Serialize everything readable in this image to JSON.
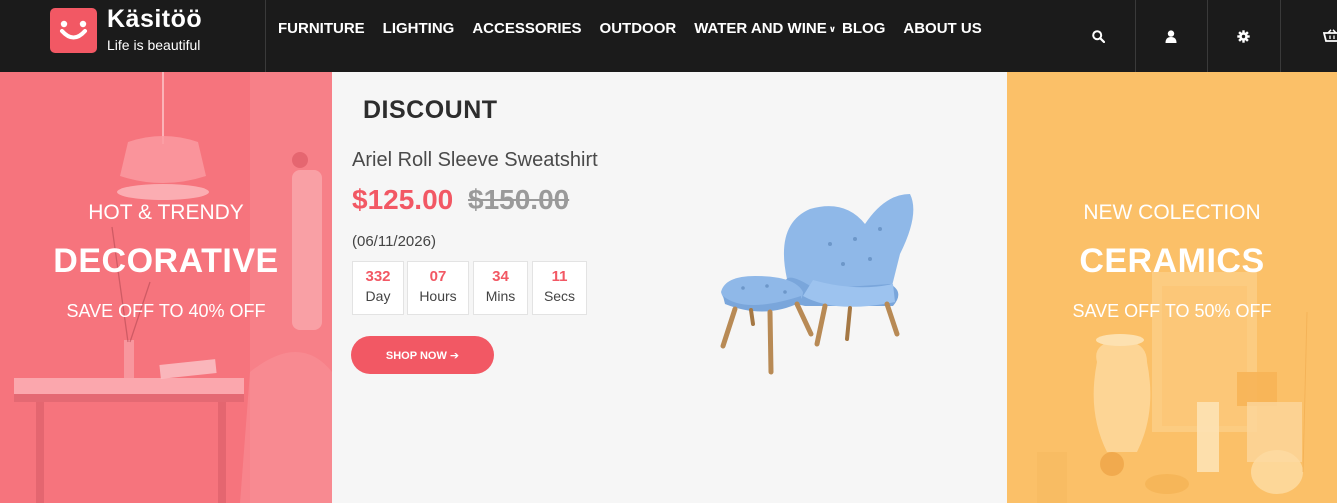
{
  "brand": {
    "name": "Käsitöö",
    "tagline": "Life is beautiful"
  },
  "nav": [
    {
      "label": "FURNITURE"
    },
    {
      "label": "LIGHTING"
    },
    {
      "label": "ACCESSORIES"
    },
    {
      "label": "OUTDOOR"
    },
    {
      "label": "WATER AND WINE"
    },
    {
      "label": "BLOG"
    },
    {
      "label": "ABOUT US"
    }
  ],
  "header_icons": [
    "search-icon",
    "user-icon",
    "gear-icon",
    "cart-icon"
  ],
  "left_banner": {
    "kicker": "HOT & TRENDY",
    "title": "DECORATIVE",
    "subtitle": "SAVE OFF TO 40% OFF"
  },
  "right_banner": {
    "kicker": "NEW COLECTION",
    "title": "CERAMICS",
    "subtitle": "SAVE OFF TO 50% OFF"
  },
  "deal": {
    "section_title": "DISCOUNT",
    "product_name": "Ariel Roll Sleeve Sweatshirt",
    "price_now": "$125.00",
    "price_old": "$150.00",
    "date": "(06/11/2026)",
    "countdown": {
      "days": "332",
      "days_label": "Day",
      "hours": "07",
      "hours_label": "Hours",
      "mins": "34",
      "mins_label": "Mins",
      "secs": "11",
      "secs_label": "Secs"
    },
    "button_label": "SHOP NOW ➔"
  },
  "colors": {
    "accent": "#f25864",
    "header_bg": "#1b1b1b",
    "left_banner": "#f6737c",
    "right_banner": "#fbbf62",
    "chair": "#8fb8e8"
  }
}
